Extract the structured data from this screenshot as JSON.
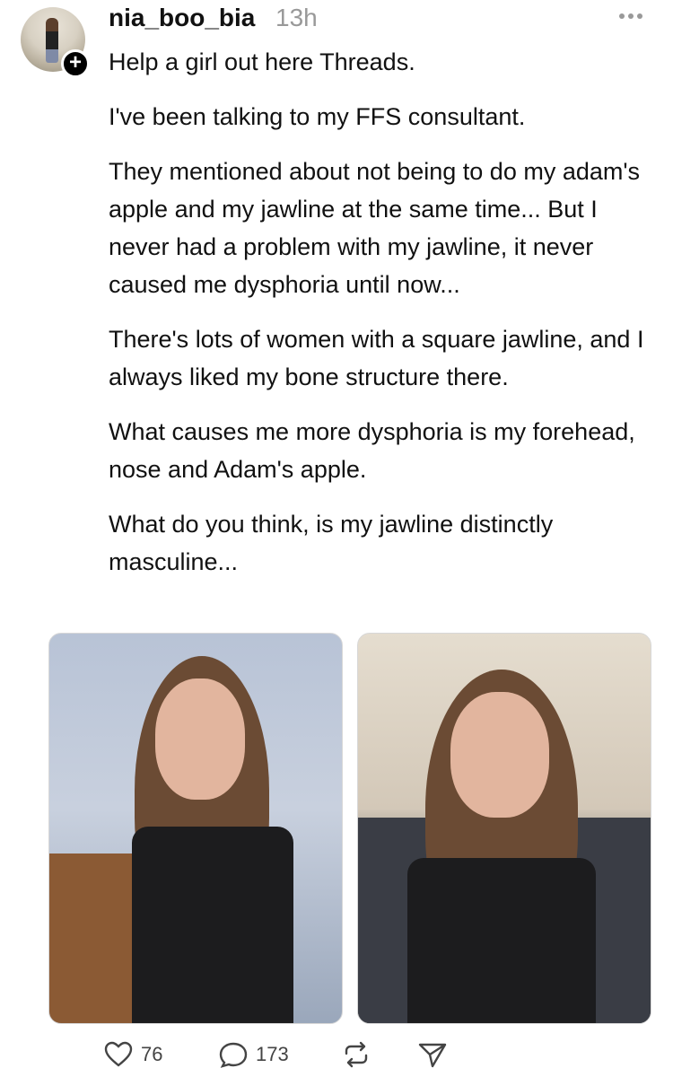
{
  "post": {
    "username": "nia_boo_bia",
    "timestamp": "13h",
    "paragraphs": [
      "Help a girl out here Threads.",
      "I've been talking to my FFS consultant.",
      "They mentioned about not being to do my adam's apple and my jawline at the same time... But I never had a problem with my jawline, it never caused me dysphoria until now...",
      "There's lots of women with a square jawline, and I always liked my bone structure there.",
      "What causes me more dysphoria is my forehead, nose and Adam's apple.",
      "What do you think, is my jawline distinctly masculine..."
    ]
  },
  "actions": {
    "likes": "76",
    "comments": "173"
  },
  "icons": {
    "more": "more-options-icon",
    "follow": "plus-icon",
    "like": "heart-icon",
    "comment": "comment-icon",
    "repost": "repost-icon",
    "share": "send-icon"
  }
}
